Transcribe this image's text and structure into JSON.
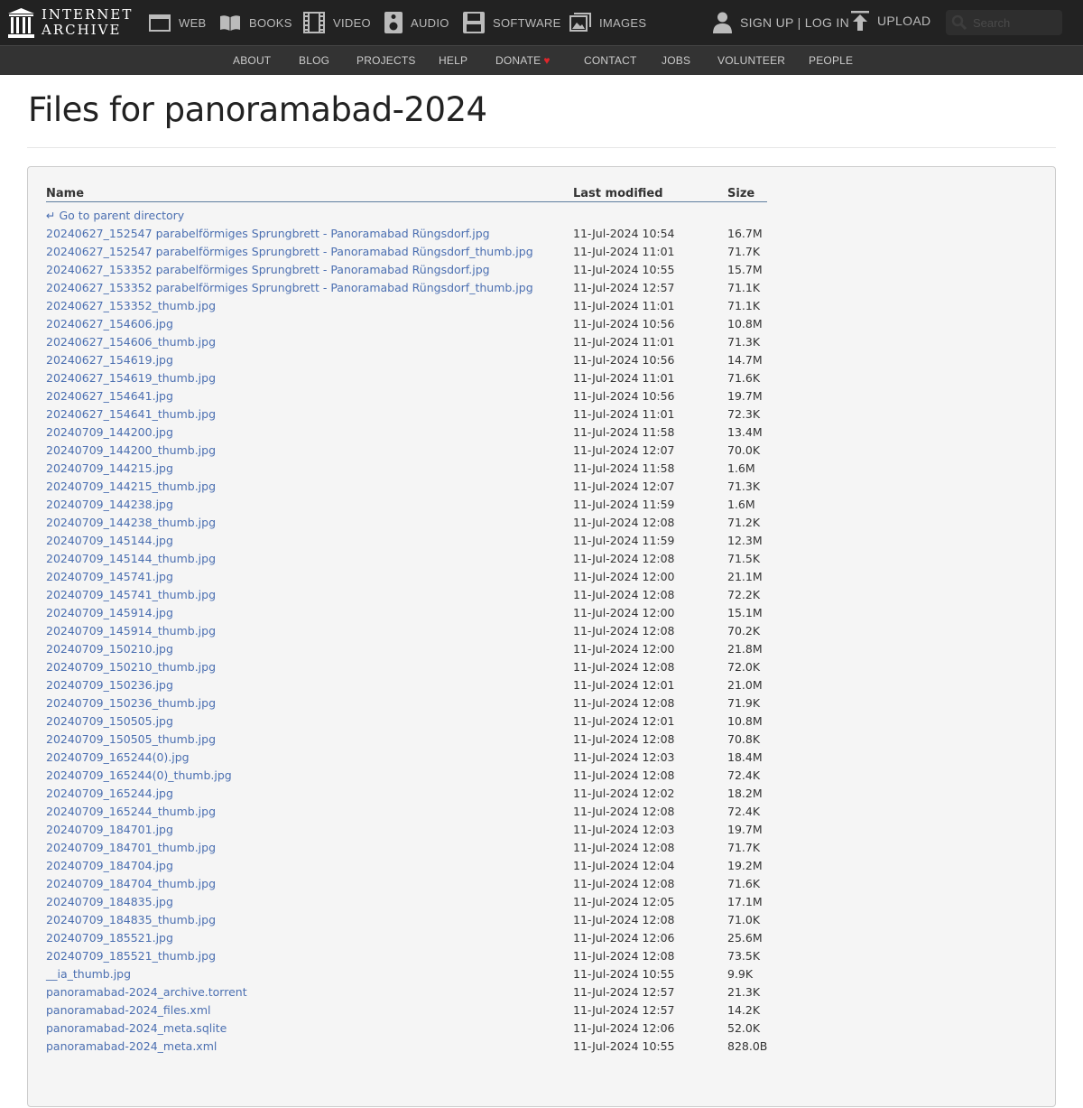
{
  "header": {
    "logo_line1": "INTERNET",
    "logo_line2": "ARCHIVE",
    "nav": [
      {
        "label": "WEB",
        "icon": "web-icon"
      },
      {
        "label": "BOOKS",
        "icon": "books-icon"
      },
      {
        "label": "VIDEO",
        "icon": "video-icon"
      },
      {
        "label": "AUDIO",
        "icon": "audio-icon"
      },
      {
        "label": "SOFTWARE",
        "icon": "software-icon"
      },
      {
        "label": "IMAGES",
        "icon": "images-icon"
      }
    ],
    "account": {
      "label": "SIGN UP | LOG IN",
      "icon": "user-icon"
    },
    "upload": {
      "label": "UPLOAD",
      "icon": "upload-icon"
    },
    "search_placeholder": "Search"
  },
  "subnav": [
    "ABOUT",
    "BLOG",
    "PROJECTS",
    "HELP",
    "DONATE",
    "CONTACT",
    "JOBS",
    "VOLUNTEER",
    "PEOPLE"
  ],
  "colors": {
    "topbar": "#222222",
    "subbar": "#333333",
    "link": "#4b6fb1",
    "heart": "#e0262b"
  },
  "page": {
    "title": "Files for panoramabad-2024"
  },
  "listing": {
    "headers": {
      "name": "Name",
      "modified": "Last modified",
      "size": "Size"
    },
    "parent_label": "Go to parent directory",
    "files": [
      [
        "20240627_152547 parabelförmiges Sprungbrett - Panoramabad Rüngsdorf.jpg",
        "11-Jul-2024 10:54",
        "16.7M"
      ],
      [
        "20240627_152547 parabelförmiges Sprungbrett - Panoramabad Rüngsdorf_thumb.jpg",
        "11-Jul-2024 11:01",
        "71.7K"
      ],
      [
        "20240627_153352 parabelförmiges Sprungbrett - Panoramabad Rüngsdorf.jpg",
        "11-Jul-2024 10:55",
        "15.7M"
      ],
      [
        "20240627_153352 parabelförmiges Sprungbrett - Panoramabad Rüngsdorf_thumb.jpg",
        "11-Jul-2024 12:57",
        "71.1K"
      ],
      [
        "20240627_153352_thumb.jpg",
        "11-Jul-2024 11:01",
        "71.1K"
      ],
      [
        "20240627_154606.jpg",
        "11-Jul-2024 10:56",
        "10.8M"
      ],
      [
        "20240627_154606_thumb.jpg",
        "11-Jul-2024 11:01",
        "71.3K"
      ],
      [
        "20240627_154619.jpg",
        "11-Jul-2024 10:56",
        "14.7M"
      ],
      [
        "20240627_154619_thumb.jpg",
        "11-Jul-2024 11:01",
        "71.6K"
      ],
      [
        "20240627_154641.jpg",
        "11-Jul-2024 10:56",
        "19.7M"
      ],
      [
        "20240627_154641_thumb.jpg",
        "11-Jul-2024 11:01",
        "72.3K"
      ],
      [
        "20240709_144200.jpg",
        "11-Jul-2024 11:58",
        "13.4M"
      ],
      [
        "20240709_144200_thumb.jpg",
        "11-Jul-2024 12:07",
        "70.0K"
      ],
      [
        "20240709_144215.jpg",
        "11-Jul-2024 11:58",
        "1.6M"
      ],
      [
        "20240709_144215_thumb.jpg",
        "11-Jul-2024 12:07",
        "71.3K"
      ],
      [
        "20240709_144238.jpg",
        "11-Jul-2024 11:59",
        "1.6M"
      ],
      [
        "20240709_144238_thumb.jpg",
        "11-Jul-2024 12:08",
        "71.2K"
      ],
      [
        "20240709_145144.jpg",
        "11-Jul-2024 11:59",
        "12.3M"
      ],
      [
        "20240709_145144_thumb.jpg",
        "11-Jul-2024 12:08",
        "71.5K"
      ],
      [
        "20240709_145741.jpg",
        "11-Jul-2024 12:00",
        "21.1M"
      ],
      [
        "20240709_145741_thumb.jpg",
        "11-Jul-2024 12:08",
        "72.2K"
      ],
      [
        "20240709_145914.jpg",
        "11-Jul-2024 12:00",
        "15.1M"
      ],
      [
        "20240709_145914_thumb.jpg",
        "11-Jul-2024 12:08",
        "70.2K"
      ],
      [
        "20240709_150210.jpg",
        "11-Jul-2024 12:00",
        "21.8M"
      ],
      [
        "20240709_150210_thumb.jpg",
        "11-Jul-2024 12:08",
        "72.0K"
      ],
      [
        "20240709_150236.jpg",
        "11-Jul-2024 12:01",
        "21.0M"
      ],
      [
        "20240709_150236_thumb.jpg",
        "11-Jul-2024 12:08",
        "71.9K"
      ],
      [
        "20240709_150505.jpg",
        "11-Jul-2024 12:01",
        "10.8M"
      ],
      [
        "20240709_150505_thumb.jpg",
        "11-Jul-2024 12:08",
        "70.8K"
      ],
      [
        "20240709_165244(0).jpg",
        "11-Jul-2024 12:03",
        "18.4M"
      ],
      [
        "20240709_165244(0)_thumb.jpg",
        "11-Jul-2024 12:08",
        "72.4K"
      ],
      [
        "20240709_165244.jpg",
        "11-Jul-2024 12:02",
        "18.2M"
      ],
      [
        "20240709_165244_thumb.jpg",
        "11-Jul-2024 12:08",
        "72.4K"
      ],
      [
        "20240709_184701.jpg",
        "11-Jul-2024 12:03",
        "19.7M"
      ],
      [
        "20240709_184701_thumb.jpg",
        "11-Jul-2024 12:08",
        "71.7K"
      ],
      [
        "20240709_184704.jpg",
        "11-Jul-2024 12:04",
        "19.2M"
      ],
      [
        "20240709_184704_thumb.jpg",
        "11-Jul-2024 12:08",
        "71.6K"
      ],
      [
        "20240709_184835.jpg",
        "11-Jul-2024 12:05",
        "17.1M"
      ],
      [
        "20240709_184835_thumb.jpg",
        "11-Jul-2024 12:08",
        "71.0K"
      ],
      [
        "20240709_185521.jpg",
        "11-Jul-2024 12:06",
        "25.6M"
      ],
      [
        "20240709_185521_thumb.jpg",
        "11-Jul-2024 12:08",
        "73.5K"
      ],
      [
        "__ia_thumb.jpg",
        "11-Jul-2024 10:55",
        "9.9K"
      ],
      [
        "panoramabad-2024_archive.torrent",
        "11-Jul-2024 12:57",
        "21.3K"
      ],
      [
        "panoramabad-2024_files.xml",
        "11-Jul-2024 12:57",
        "14.2K"
      ],
      [
        "panoramabad-2024_meta.sqlite",
        "11-Jul-2024 12:06",
        "52.0K"
      ],
      [
        "panoramabad-2024_meta.xml",
        "11-Jul-2024 10:55",
        "828.0B"
      ]
    ]
  }
}
